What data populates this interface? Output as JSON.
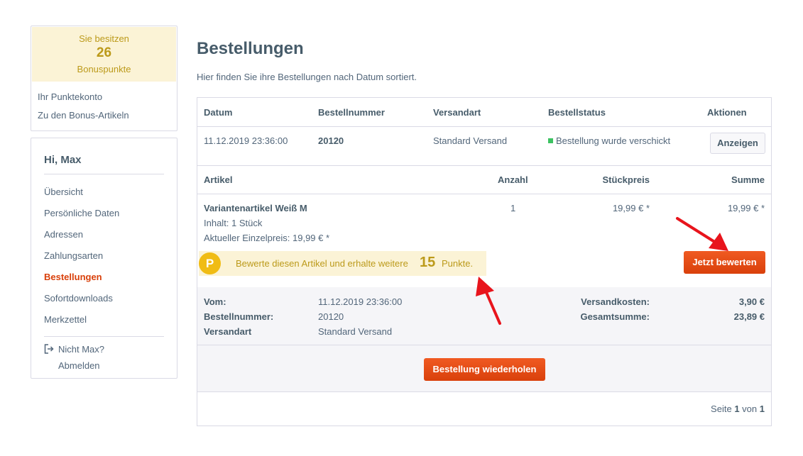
{
  "bonus": {
    "line1": "Sie besitzen",
    "points": "26",
    "line3": "Bonuspunkte",
    "links": [
      "Ihr Punktekonto",
      "Zu den Bonus-Artikeln"
    ]
  },
  "account": {
    "greeting": "Hi, Max",
    "nav": [
      "Übersicht",
      "Persönliche Daten",
      "Adressen",
      "Zahlungsarten",
      "Bestellungen",
      "Sofortdownloads",
      "Merkzettel"
    ],
    "active_nav": "Bestellungen",
    "logout_line1": "Nicht Max?",
    "logout_line2": "Abmelden"
  },
  "page": {
    "title": "Bestellungen",
    "description": "Hier finden Sie ihre Bestellungen nach Datum sortiert."
  },
  "orders_table": {
    "headers": [
      "Datum",
      "Bestellnummer",
      "Versandart",
      "Bestellstatus",
      "Aktionen"
    ],
    "row": {
      "date": "11.12.2019 23:36:00",
      "order_number": "20120",
      "shipping": "Standard Versand",
      "status": "Bestellung wurde verschickt",
      "status_color": "#3cc261",
      "action_label": "Anzeigen"
    }
  },
  "items_table": {
    "headers": [
      "Artikel",
      "Anzahl",
      "Stückpreis",
      "Summe"
    ],
    "item": {
      "name": "Variantenartikel Weiß M",
      "content": "Inhalt: 1 Stück",
      "unit_price_note": "Aktueller Einzelpreis: 19,99 € *",
      "quantity": "1",
      "unit_price": "19,99 € *",
      "total": "19,99 € *"
    },
    "points_hint": {
      "icon_letter": "P",
      "text_before": "Bewerte diesen Artikel und erhalte weitere",
      "points": "15",
      "text_after": "Punkte."
    },
    "rate_button": "Jetzt bewerten"
  },
  "summary": {
    "left_labels": [
      "Vom:",
      "Bestellnummer:",
      "Versandart"
    ],
    "left_values": [
      "11.12.2019 23:36:00",
      "20120",
      "Standard Versand"
    ],
    "right_labels": [
      "Versandkosten:",
      "Gesamtsumme:"
    ],
    "right_values": [
      "3,90 €",
      "23,89 €"
    ]
  },
  "repeat_button": "Bestellung wiederholen",
  "pagination": {
    "prefix": "Seite",
    "current": "1",
    "middle": "von",
    "total": "1"
  },
  "colors": {
    "accent": "#d9400b",
    "bonus_bg": "#fbf3d6",
    "bonus_text": "#bc9a1a",
    "arrow": "#e8141c"
  }
}
